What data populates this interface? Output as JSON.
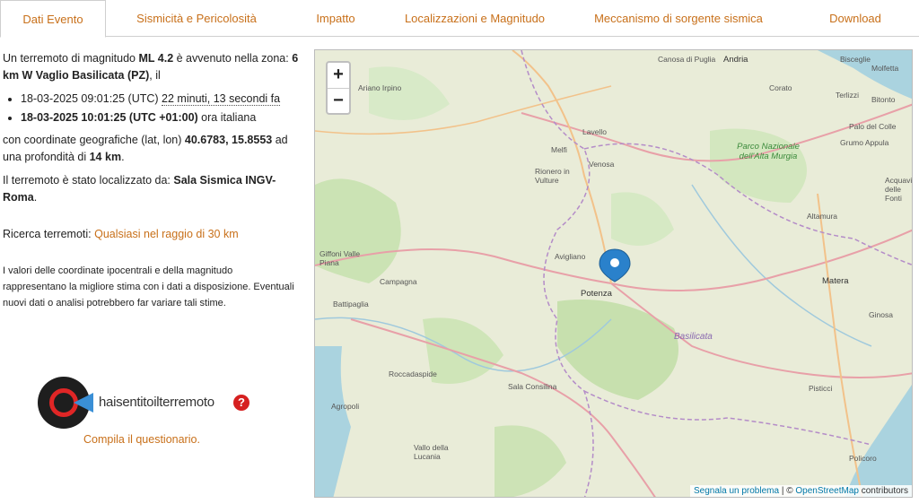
{
  "tabs": [
    {
      "label": "Dati Evento",
      "active": true
    },
    {
      "label": "Sismicità e Pericolosità"
    },
    {
      "label": "Impatto"
    },
    {
      "label": "Localizzazioni e Magnitudo"
    },
    {
      "label": "Meccanismo di sorgente sismica"
    },
    {
      "label": "Download"
    }
  ],
  "event": {
    "intro_1": "Un terremoto di magnitudo ",
    "magnitude": "ML 4.2",
    "intro_2": " è avvenuto nella zona: ",
    "zone": "6 km W Vaglio Basilicata (PZ)",
    "intro_3": ", il",
    "utc_time": "18-03-2025 09:01:25 (UTC)",
    "elapsed": "22 minuti, 13 secondi fa",
    "local_time": "18-03-2025 10:01:25 (UTC +01:00)",
    "local_suffix": " ora italiana",
    "coords_prefix": "con coordinate geografiche (lat, lon) ",
    "coords": "40.6783, 15.8553",
    "depth_prefix": " ad una profondità di ",
    "depth": "14 km",
    "depth_suffix": ".",
    "localized_prefix": "Il terremoto è stato localizzato da: ",
    "localized_by": "Sala Sismica INGV-Roma",
    "localized_suffix": ".",
    "search_prefix": "Ricerca terremoti: ",
    "search_link": "Qualsiasi nel raggio di 30 km",
    "disclaimer": "I valori delle coordinate ipocentrali e della magnitudo rappresentano la migliore stima con i dati a disposizione. Eventuali nuovi dati o analisi potrebbero far variare tali stime."
  },
  "hst": {
    "logo_text": "haisentitoilterremoto",
    "q": "?",
    "link": "Compila il questionario."
  },
  "map": {
    "zoom_in": "+",
    "zoom_out": "−",
    "attr_link": "Segnala un problema",
    "attr_sep": " | © ",
    "attr_osm": "OpenStreetMap",
    "attr_suffix": " contributors",
    "labels": {
      "andria": "Andria",
      "canosa": "Canosa di Puglia",
      "bisceglie": "Bisceglie",
      "molfetta": "Molfetta",
      "ariano": "Ariano Irpino",
      "corato": "Corato",
      "terlizzi": "Terlizzi",
      "bitonto": "Bitonto",
      "lavello": "Lavello",
      "palo": "Palo del Colle",
      "grumo": "Grumo Appula",
      "melfi": "Melfi",
      "venosa": "Venosa",
      "rionero": "Rionero in Vulture",
      "park": "Parco Nazionale dell'Alta Murgia",
      "acquaviva": "Acquaviva delle Fonti",
      "altamura": "Altamura",
      "giffoni": "Giffoni Valle Piana",
      "avigliano": "Avigliano",
      "campagna": "Campagna",
      "potenza": "Potenza",
      "battipaglia": "Battipaglia",
      "matera": "Matera",
      "ginosa": "Ginosa",
      "basilicata": "Basilicata",
      "roccadaspide": "Roccadaspide",
      "sala": "Sala Consilina",
      "agropoli": "Agropoli",
      "pisticci": "Pisticci",
      "vallo": "Vallo della Lucania",
      "policoro": "Policoro"
    }
  }
}
